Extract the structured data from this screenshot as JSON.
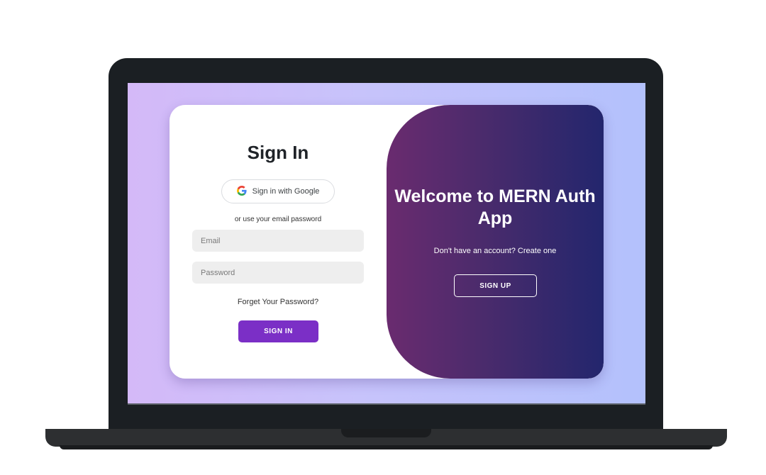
{
  "signin": {
    "title": "Sign In",
    "google_label": "Sign in with Google",
    "divider_text": "or use your email password",
    "email_placeholder": "Email",
    "email_value": "",
    "password_placeholder": "Password",
    "password_value": "",
    "forgot_label": "Forget Your Password?",
    "submit_label": "SIGN IN"
  },
  "welcome": {
    "title": "Welcome to MERN Auth App",
    "subtitle": "Don't have an account? Create one",
    "signup_label": "SIGN UP"
  },
  "icons": {
    "google": "google-g-logo"
  },
  "colors": {
    "primary_button": "#7b2fc6",
    "welcome_gradient_start": "#6a2b6f",
    "welcome_gradient_end": "#23266d",
    "screen_gradient_start": "#d4b9f8",
    "screen_gradient_end": "#b3c1fc"
  }
}
